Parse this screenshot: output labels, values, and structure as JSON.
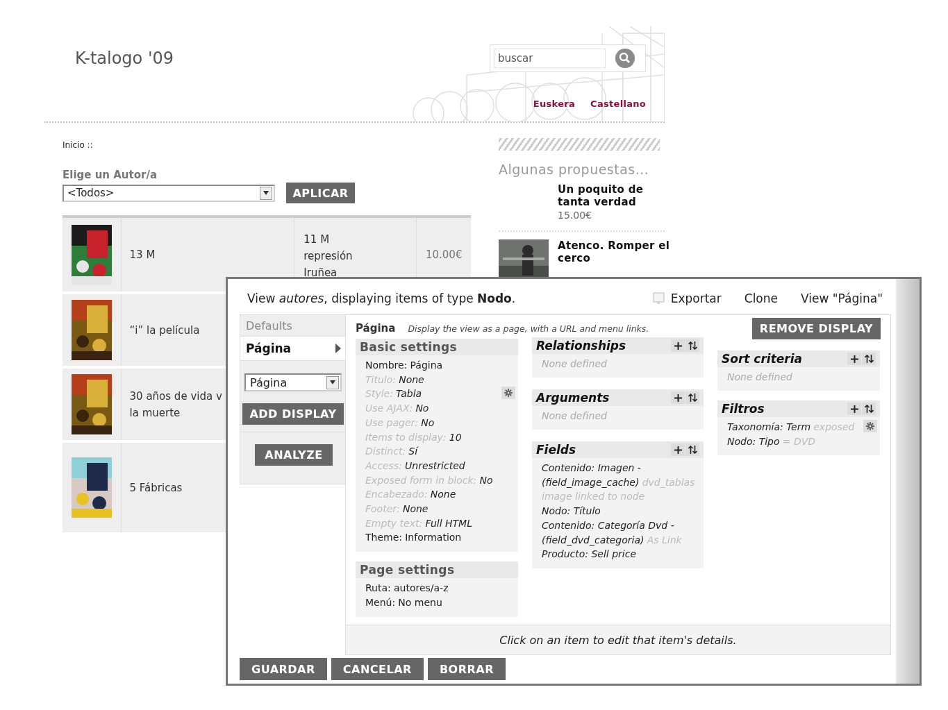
{
  "site": {
    "title": "K-talogo '09",
    "search": {
      "placeholder": "buscar"
    },
    "languages": [
      "Euskera",
      "Castellano"
    ],
    "breadcrumb": "Inicio ::",
    "filter": {
      "label": "Elige un Autor/a",
      "value": "<Todos>",
      "button": "APLICAR"
    },
    "rows": [
      {
        "title": [
          "13 M"
        ],
        "author": [
          "11 M",
          "represión",
          "Iruñea"
        ],
        "price": "10.00€"
      },
      {
        "title": [
          "“i” la película"
        ]
      },
      {
        "title": [
          "30 años de vida v",
          "la muerte"
        ]
      },
      {
        "title": [
          "5 Fábricas"
        ]
      }
    ],
    "sidebar": {
      "heading": "Algunas propuestas...",
      "items": [
        {
          "title": [
            "Un poquito de",
            "tanta verdad"
          ],
          "price": "15.00€",
          "image": false
        },
        {
          "title": [
            "Atenco. Romper el",
            "cerco"
          ],
          "image": true
        }
      ]
    }
  },
  "view": {
    "summary": "View *autores*, displaying items of type **Nodo**.",
    "links": [
      {
        "label": "Exportar",
        "kind": "export"
      },
      {
        "label": "Clone",
        "kind": "plain"
      },
      {
        "label": "View \"Página\"",
        "kind": "plain"
      }
    ],
    "displays": [
      {
        "label": "Defaults",
        "selected": false
      },
      {
        "label": "Página",
        "selected": true
      }
    ],
    "display_select": "Página",
    "add_display": "ADD DISPLAY",
    "analyze": "ANALYZE",
    "current": {
      "title": "Página",
      "description": "Display the view as a page, with a URL and menu links.",
      "remove": "REMOVE DISPLAY"
    },
    "columns": [
      [
        {
          "title": "Basic settings",
          "defaulted": false,
          "actions": false,
          "items": [
            {
              "label": "Nombre:",
              "value": "Página",
              "defaulted": false
            },
            {
              "label": "Titulo:",
              "value": "None",
              "defaulted": true
            },
            {
              "label": "Style:",
              "value": "Tabla",
              "defaulted": true,
              "gear": true
            },
            {
              "label": "Use AJAX:",
              "value": "No",
              "defaulted": true
            },
            {
              "label": "Use pager:",
              "value": "No",
              "defaulted": true
            },
            {
              "label": "Items to display:",
              "value": "10",
              "defaulted": true
            },
            {
              "label": "Distinct:",
              "value": "Sí",
              "defaulted": true
            },
            {
              "label": "Access:",
              "value": "Unrestricted",
              "defaulted": true
            },
            {
              "label": "Exposed form in block:",
              "value": "No",
              "defaulted": true
            },
            {
              "label": "Encabezado:",
              "value": "None",
              "defaulted": true
            },
            {
              "label": "Footer:",
              "value": "None",
              "defaulted": true
            },
            {
              "label": "Empty text:",
              "value": "Full HTML",
              "defaulted": true
            },
            {
              "label": "Theme:",
              "value": "Information",
              "defaulted": false
            }
          ]
        },
        {
          "title": "Page settings",
          "defaulted": false,
          "actions": false,
          "items": [
            {
              "label": "Ruta:",
              "value": "autores/a-z",
              "defaulted": false
            },
            {
              "label": "Menú:",
              "value": "No menu",
              "defaulted": false
            }
          ]
        }
      ],
      [
        {
          "title": "Relationships",
          "defaulted": true,
          "actions": true,
          "empty": "None defined"
        },
        {
          "title": "Arguments",
          "defaulted": true,
          "actions": true,
          "empty": "None defined"
        },
        {
          "title": "Fields",
          "defaulted": true,
          "actions": true,
          "items": [
            {
              "value": "Contenido: Imagen - (field_image_cache)",
              "note": "dvd_tablas image linked to node",
              "defaulted": true
            },
            {
              "value": "Nodo: Título",
              "defaulted": true
            },
            {
              "value": "Contenido: Categoría Dvd - (field_dvd_categoria)",
              "note": "As Link",
              "defaulted": true
            },
            {
              "value": "Producto: Sell price",
              "defaulted": true
            }
          ]
        }
      ],
      [
        {
          "title": "Sort criteria",
          "defaulted": true,
          "actions": true,
          "empty": "None defined"
        },
        {
          "title": "Filtros",
          "defaulted": true,
          "actions": true,
          "items": [
            {
              "value": "Taxonomía: Term",
              "note": "exposed",
              "defaulted": true,
              "gear": true
            },
            {
              "value": "Nodo: Tipo",
              "note": "= DVD",
              "defaulted": true
            }
          ]
        }
      ]
    ],
    "hint": "Click on an item to edit that item's details.",
    "buttons": [
      "GUARDAR",
      "CANCELAR",
      "BORRAR"
    ]
  }
}
